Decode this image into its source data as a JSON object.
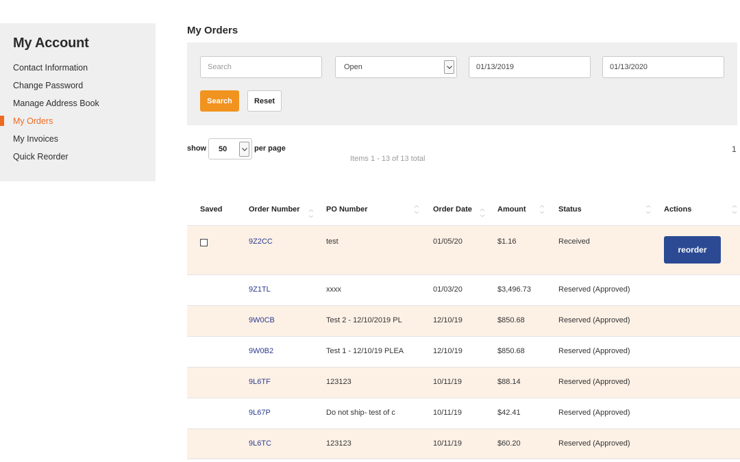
{
  "sidebar": {
    "title": "My Account",
    "items": [
      {
        "label": "Contact Information"
      },
      {
        "label": "Change Password"
      },
      {
        "label": "Manage Address Book"
      },
      {
        "label": "My Orders",
        "active": true
      },
      {
        "label": "My Invoices"
      },
      {
        "label": "Quick Reorder"
      }
    ]
  },
  "main": {
    "title": "My Orders"
  },
  "filters": {
    "search_placeholder": "Search",
    "search_value": "",
    "status_value": "Open",
    "date_from": "01/13/2019",
    "date_to": "01/13/2020",
    "search_label": "Search",
    "reset_label": "Reset"
  },
  "pager": {
    "show_label": "show",
    "per_page_value": "50",
    "per_page_label": "per page",
    "items_text": "Items 1 - 13 of 13 total",
    "page": "1"
  },
  "table": {
    "headers": {
      "saved": "Saved",
      "order_number": "Order Number",
      "po_number": "PO Number",
      "order_date": "Order Date",
      "amount": "Amount",
      "status": "Status",
      "actions": "Actions"
    },
    "reorder_label": "reorder",
    "rows": [
      {
        "order": "9Z2CC",
        "po": "test",
        "date": "01/05/20",
        "amount": "$1.16",
        "status": "Received"
      },
      {
        "order": "9Z1TL",
        "po": "xxxx",
        "date": "01/03/20",
        "amount": "$3,496.73",
        "status": "Reserved (Approved)"
      },
      {
        "order": "9W0CB",
        "po": "Test 2 - 12/10/2019 PL",
        "date": "12/10/19",
        "amount": "$850.68",
        "status": "Reserved (Approved)"
      },
      {
        "order": "9W0B2",
        "po": "Test 1 - 12/10/19 PLEA",
        "date": "12/10/19",
        "amount": "$850.68",
        "status": "Reserved (Approved)"
      },
      {
        "order": "9L6TF",
        "po": "123123",
        "date": "10/11/19",
        "amount": "$88.14",
        "status": "Reserved (Approved)"
      },
      {
        "order": "9L67P",
        "po": "Do not ship- test of c",
        "date": "10/11/19",
        "amount": "$42.41",
        "status": "Reserved (Approved)"
      },
      {
        "order": "9L6TC",
        "po": "123123",
        "date": "10/11/19",
        "amount": "$60.20",
        "status": "Reserved (Approved)"
      }
    ]
  },
  "colors": {
    "accent": "#ef6a21",
    "search_button": "#f1931f",
    "reorder_button": "#2b4a93",
    "row_highlight": "#fdf1e6",
    "link": "#2a3a8c"
  }
}
